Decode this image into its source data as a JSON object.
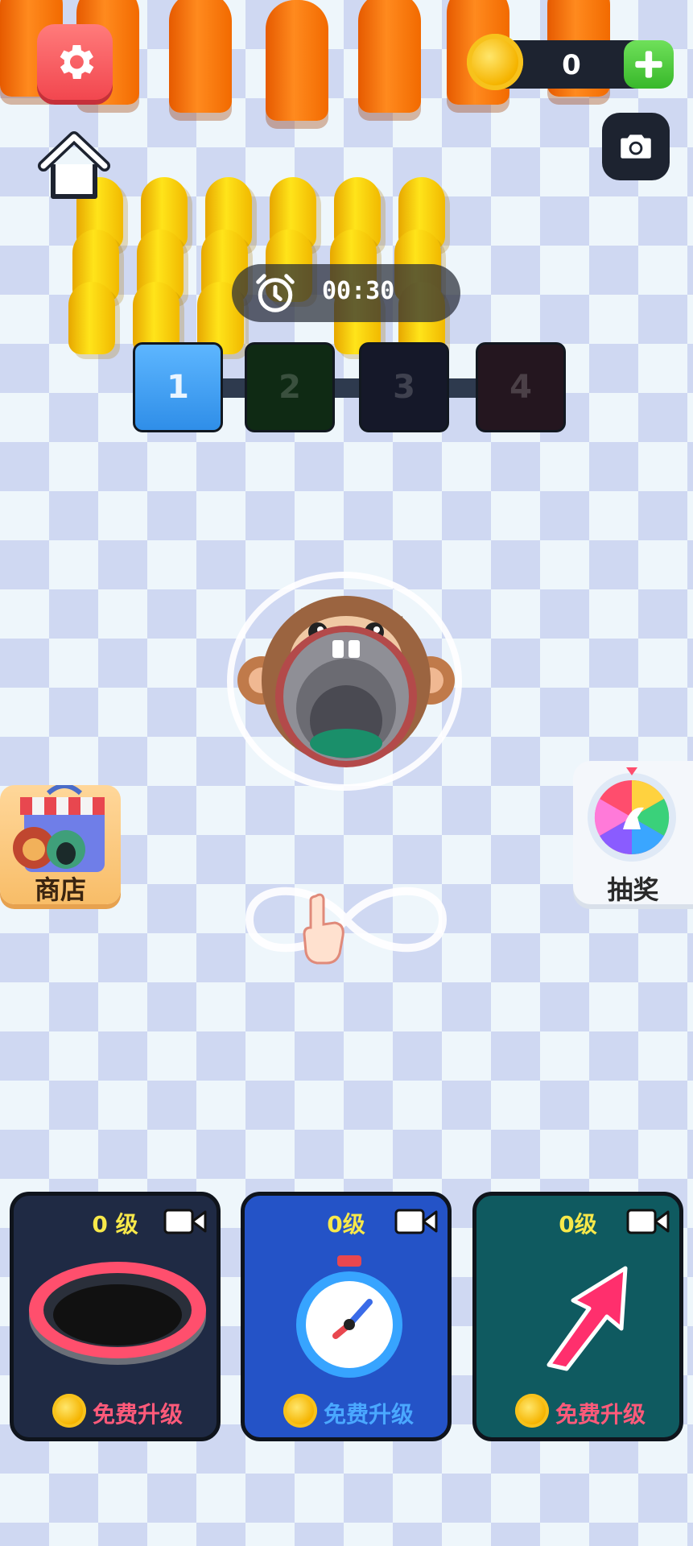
{
  "hud": {
    "coins": "0",
    "timer": "00:30"
  },
  "levels": [
    {
      "label": "1",
      "state": "active"
    },
    {
      "label": "2",
      "state": "locked"
    },
    {
      "label": "3",
      "state": "locked"
    },
    {
      "label": "4",
      "state": "locked"
    }
  ],
  "side": {
    "shop_label": "商店",
    "lottery_label": "抽奖"
  },
  "upgrades": [
    {
      "level": "0 级",
      "action": "免费升级",
      "icon": "hole-ring-icon",
      "bg": "#1f2a44"
    },
    {
      "level": "0级",
      "action": "免费升级",
      "icon": "stopwatch-icon",
      "bg": "#2453c7"
    },
    {
      "level": "0级",
      "action": "免费升级",
      "icon": "arrow-up-right-icon",
      "bg": "#0f5a60"
    }
  ],
  "colors": {
    "upgrade_text": "#ff5a7a",
    "upgrade_text_blue": "#4aa8ff",
    "level_text": "#f7e84a"
  }
}
